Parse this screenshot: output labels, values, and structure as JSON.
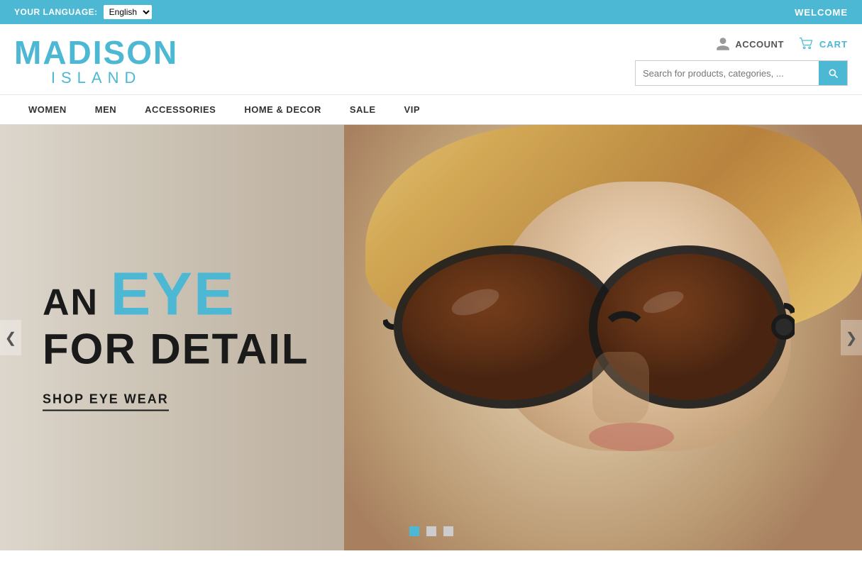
{
  "topbar": {
    "language_label": "YOUR LANGUAGE:",
    "language_value": "English",
    "welcome_text": "WELCOME"
  },
  "header": {
    "logo_madison": "MADISON",
    "logo_island": "ISLAND",
    "account_label": "ACCOUNT",
    "cart_label": "CART",
    "search_placeholder": "Search for products, categories, ..."
  },
  "nav": {
    "items": [
      {
        "label": "WOMEN",
        "id": "women"
      },
      {
        "label": "MEN",
        "id": "men"
      },
      {
        "label": "ACCESSORIES",
        "id": "accessories"
      },
      {
        "label": "HOME & DECOR",
        "id": "home-decor"
      },
      {
        "label": "SALE",
        "id": "sale"
      },
      {
        "label": "VIP",
        "id": "vip"
      }
    ]
  },
  "hero": {
    "line_an": "AN",
    "line_eye": "EYE",
    "line_for_detail": "FOR DETAIL",
    "cta_text": "SHOP EYE WEAR",
    "arrow_left": "❮",
    "arrow_right": "❯",
    "dots": [
      {
        "active": true
      },
      {
        "active": false
      },
      {
        "active": false
      }
    ]
  }
}
